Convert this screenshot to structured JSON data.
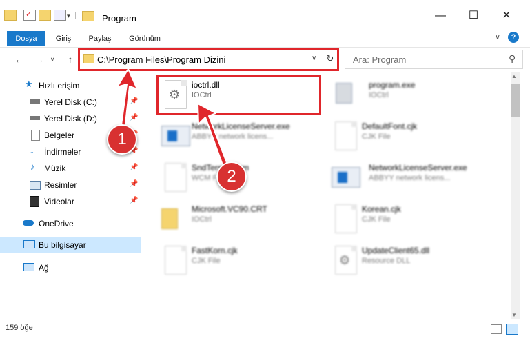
{
  "window": {
    "title": "Program",
    "minimize": "—",
    "maximize": "☐",
    "close": "✕"
  },
  "ribbon": {
    "tabs": [
      "Dosya",
      "Giriş",
      "Paylaş",
      "Görünüm"
    ],
    "expand": "∨",
    "help": "?"
  },
  "address": {
    "path": "C:\\Program Files\\Program Dizini",
    "dropdown": "∨",
    "refresh": "↻"
  },
  "search": {
    "placeholder": "Ara: Program"
  },
  "nav_buttons": {
    "back": "←",
    "forward": "→",
    "recent": "∨",
    "up": "↑"
  },
  "nav": {
    "quick_access": "Hızlı erişim",
    "items": [
      {
        "label": "Yerel Disk (C:)",
        "icon": "drive-icon",
        "pinned": true
      },
      {
        "label": "Yerel Disk (D:)",
        "icon": "drive-icon",
        "pinned": true
      },
      {
        "label": "Belgeler",
        "icon": "documents-icon",
        "pinned": true
      },
      {
        "label": "İndirmeler",
        "icon": "downloads-icon",
        "pinned": true
      },
      {
        "label": "Müzik",
        "icon": "music-icon",
        "pinned": true
      },
      {
        "label": "Resimler",
        "icon": "pictures-icon",
        "pinned": true
      },
      {
        "label": "Videolar",
        "icon": "videos-icon",
        "pinned": true
      }
    ],
    "onedrive": "OneDrive",
    "this_pc": "Bu bilgisayar",
    "network": "Ağ"
  },
  "files": [
    {
      "name": "ioctrl.dll",
      "type": "IOCtrl",
      "icon": "dll-gear-icon",
      "highlighted": true
    },
    {
      "name": "program.exe",
      "type": "IOCtrl",
      "icon": "exe-icon"
    },
    {
      "name": "NetworkLicenseServer.exe",
      "type": "ABBYY network licens...",
      "icon": "exe-icon"
    },
    {
      "name": "DefaultFont.cjk",
      "type": "CJK File",
      "icon": "file-icon"
    },
    {
      "name": "SndTerm.elecm",
      "type": "WCM File",
      "icon": "file-icon"
    },
    {
      "name": "NetworkLicenseServer.exe",
      "type": "ABBYY network licens...",
      "icon": "exe-icon"
    },
    {
      "name": "Microsoft.VC90.CRT",
      "type": "IOCtrl",
      "icon": "folder-icon"
    },
    {
      "name": "Korean.cjk",
      "type": "CJK File",
      "icon": "file-icon"
    },
    {
      "name": "FastKorn.cjk",
      "type": "CJK File",
      "icon": "file-icon"
    },
    {
      "name": "UpdateClient65.dll",
      "type": "Resource DLL",
      "icon": "dll-gear-icon"
    }
  ],
  "status": {
    "count": "159 öğe"
  },
  "annotations": {
    "marker1": "1",
    "marker2": "2"
  },
  "colors": {
    "accent": "#1979ca",
    "annotation_red": "#e0262b",
    "selection": "#cce8ff"
  }
}
